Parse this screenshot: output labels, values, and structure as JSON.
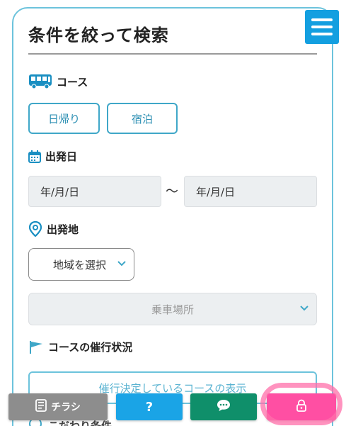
{
  "panel": {
    "title": "条件を絞って検索"
  },
  "sections": {
    "course": {
      "label": "コース",
      "icon": "bus-icon",
      "options": [
        "日帰り",
        "宿泊"
      ]
    },
    "departure_date": {
      "label": "出発日",
      "icon": "calendar-icon",
      "from_placeholder": "年/月/日",
      "separator": "〜",
      "to_placeholder": "年/月/日"
    },
    "departure_place": {
      "label": "出発地",
      "icon": "location-pin-icon",
      "region_value": "地域を選択",
      "stop_value": "乗車場所"
    },
    "operation_status": {
      "label": "コースの催行状況",
      "icon": "flag-icon",
      "button_label": "催行決定しているコースの表示"
    },
    "preferences": {
      "label": "こだわり条件"
    }
  },
  "bottom_bar": {
    "flyer_label": "チラシ",
    "help_label": "?",
    "chat_icon": "chat-bubble-icon",
    "lock_icon": "lock-icon"
  },
  "colors": {
    "accent": "#139fe0",
    "border": "#6cc3dc",
    "chat": "#0f8f6a",
    "lock": "#ff4fa3",
    "flyer": "#8d8d8d"
  }
}
